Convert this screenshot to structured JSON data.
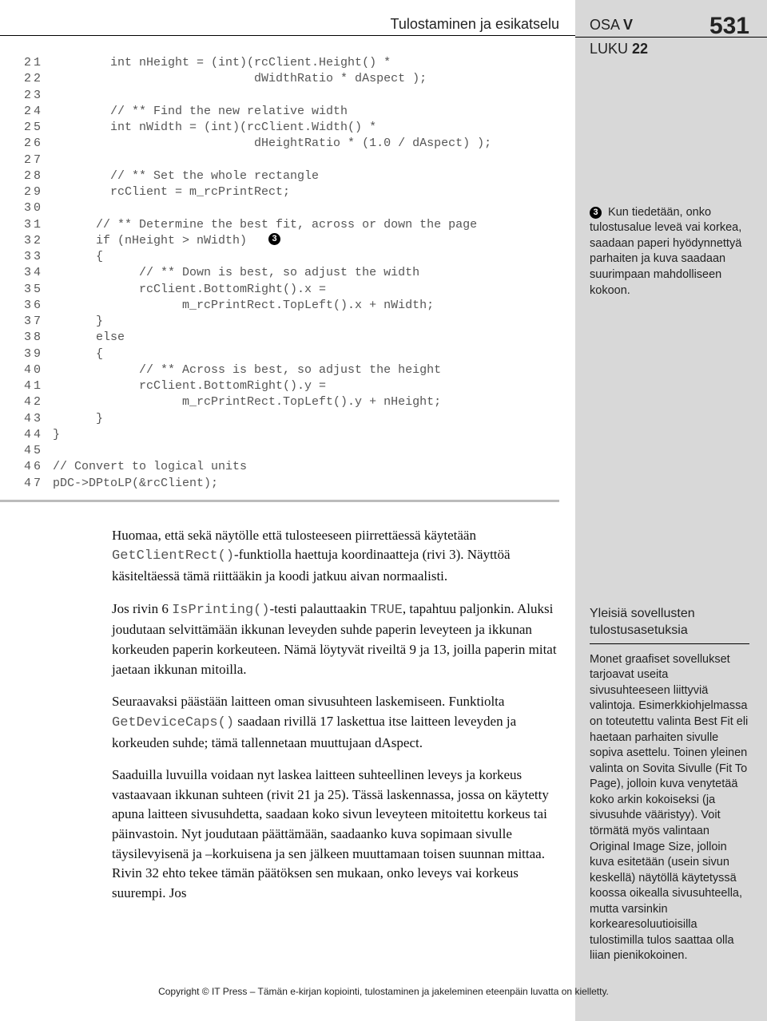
{
  "header": {
    "section_title": "Tulostaminen ja esikatselu",
    "part_label": "OSA",
    "part_num": "V",
    "chapter_label": "LUKU",
    "chapter_num": "22",
    "page_number": "531"
  },
  "code": {
    "lines": [
      {
        "n": "21",
        "t": "        int nHeight = (int)(rcClient.Height() *"
      },
      {
        "n": "22",
        "t": "                            dWidthRatio * dAspect );"
      },
      {
        "n": "23",
        "t": ""
      },
      {
        "n": "24",
        "t": "        // ** Find the new relative width"
      },
      {
        "n": "25",
        "t": "        int nWidth = (int)(rcClient.Width() *"
      },
      {
        "n": "26",
        "t": "                            dHeightRatio * (1.0 / dAspect) );"
      },
      {
        "n": "27",
        "t": ""
      },
      {
        "n": "28",
        "t": "        // ** Set the whole rectangle"
      },
      {
        "n": "29",
        "t": "        rcClient = m_rcPrintRect;"
      },
      {
        "n": "30",
        "t": ""
      },
      {
        "n": "31",
        "t": "      // ** Determine the best fit, across or down the page"
      },
      {
        "n": "32",
        "t": "      if (nHeight > nWidth)   ",
        "badge": "3"
      },
      {
        "n": "33",
        "t": "      {"
      },
      {
        "n": "34",
        "t": "            // ** Down is best, so adjust the width"
      },
      {
        "n": "35",
        "t": "            rcClient.BottomRight().x ="
      },
      {
        "n": "36",
        "t": "                  m_rcPrintRect.TopLeft().x + nWidth;"
      },
      {
        "n": "37",
        "t": "      }"
      },
      {
        "n": "38",
        "t": "      else"
      },
      {
        "n": "39",
        "t": "      {"
      },
      {
        "n": "40",
        "t": "            // ** Across is best, so adjust the height"
      },
      {
        "n": "41",
        "t": "            rcClient.BottomRight().y ="
      },
      {
        "n": "42",
        "t": "                  m_rcPrintRect.TopLeft().y + nHeight;"
      },
      {
        "n": "43",
        "t": "      }"
      },
      {
        "n": "44",
        "t": "}"
      },
      {
        "n": "45",
        "t": ""
      },
      {
        "n": "46",
        "t": "// Convert to logical units"
      },
      {
        "n": "47",
        "t": "pDC->DPtoLP(&rcClient);"
      }
    ]
  },
  "body": {
    "p1_a": "Huomaa, että sekä näytölle että tulosteeseen piirrettäessä käytetään ",
    "p1_code": "GetClientRect()",
    "p1_b": "-funktiolla haettuja koordinaatteja (rivi 3). Näyttöä käsiteltäessä tämä riittääkin ja koodi jatkuu aivan normaalisti.",
    "p2_a": "Jos rivin 6 ",
    "p2_code1": "IsPrinting()",
    "p2_b": "-testi palauttaakin ",
    "p2_code2": "TRUE",
    "p2_c": ", tapahtuu paljonkin. Aluksi joudutaan selvittämään ikkunan leveyden suhde paperin leveyteen ja ikkunan korkeuden paperin korkeuteen. Nämä löytyvät riveiltä 9 ja 13, joilla paperin mitat jaetaan ikkunan mitoilla.",
    "p3_a": "Seuraavaksi päästään laitteen oman sivusuhteen laskemiseen. Funktiolta ",
    "p3_code": "GetDeviceCaps()",
    "p3_b": " saadaan rivillä 17 laskettua itse laitteen leveyden ja korkeuden suhde; tämä tallennetaan muuttujaan dAspect.",
    "p4": "Saaduilla luvuilla voidaan nyt laskea laitteen suhteellinen leveys ja korkeus vastaavaan ikkunan suhteen (rivit 21 ja 25). Tässä laskennassa, jossa on käytetty apuna laitteen sivusuhdetta, saadaan koko sivun leveyteen mitoitettu korkeus tai päinvastoin. Nyt joudutaan päättämään, saadaanko kuva sopimaan sivulle täysilevyisenä ja –korkuisena ja sen jälkeen muuttamaan toisen suunnan mittaa. Rivin 32 ehto tekee tämän päätöksen sen mukaan, onko leveys vai korkeus suurempi. Jos"
  },
  "sidenote": {
    "badge": "3",
    "text": " Kun tiedetään, onko tulostusalue leveä vai korkea, saadaan paperi hyödynnettyä parhaiten ja kuva saadaan suurimpaan mahdolliseen kokoon."
  },
  "sidebox": {
    "title": "Yleisiä sovellusten tulostusasetuksia",
    "body": "Monet graafiset sovellukset tarjoavat useita sivusuhteeseen liittyviä valintoja. Esimerkki­ohjelmassa on toteutettu valinta Best Fit eli haetaan parhaiten sivulle sopiva asettelu. Toinen yleinen valinta on Sovita Sivulle (Fit To Page), jolloin kuva venytetää koko arkin kokoiseksi (ja sivusuhde vääristyy). Voit törmätä myös valintaan Original Image Size, jolloin kuva esitetään (usein sivun keskellä) näytöllä käytetyssä koossa oikealla sivusuhteella, mutta varsinkin korkearesoluutioisilla tulostimilla tulos saattaa olla liian pienikokoi­nen."
  },
  "footer": "Copyright © IT Press – Tämän e-kirjan kopiointi, tulostaminen ja jakeleminen eteenpäin luvatta on kielletty."
}
